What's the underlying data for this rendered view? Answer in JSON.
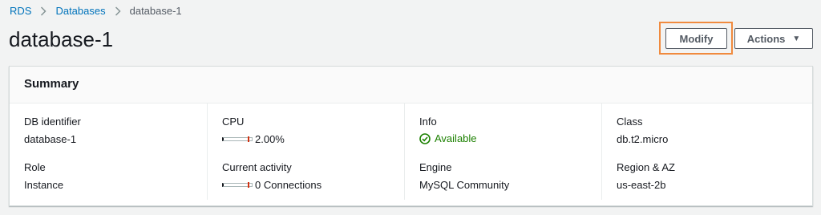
{
  "breadcrumb": {
    "root": "RDS",
    "section": "Databases",
    "current": "database-1"
  },
  "page": {
    "title": "database-1"
  },
  "actions": {
    "modify_label": "Modify",
    "actions_label": "Actions"
  },
  "summary": {
    "title": "Summary",
    "db_identifier": {
      "label": "DB identifier",
      "value": "database-1"
    },
    "role": {
      "label": "Role",
      "value": "Instance"
    },
    "cpu": {
      "label": "CPU",
      "value": "2.00%",
      "level": 0.02
    },
    "current_activity": {
      "label": "Current activity",
      "value": "0 Connections",
      "level": 0
    },
    "info": {
      "label": "Info",
      "value": "Available"
    },
    "engine": {
      "label": "Engine",
      "value": "MySQL Community"
    },
    "class": {
      "label": "Class",
      "value": "db.t2.micro"
    },
    "region": {
      "label": "Region & AZ",
      "value": "us-east-2b"
    }
  },
  "colors": {
    "link": "#0073bb",
    "success": "#1d8102",
    "highlight": "#f08a3e",
    "meter_threshold": "#d13212"
  },
  "icons": {
    "separator": "chevron-right-icon",
    "status": "check-circle-icon",
    "dropdown": "caret-down-icon"
  }
}
